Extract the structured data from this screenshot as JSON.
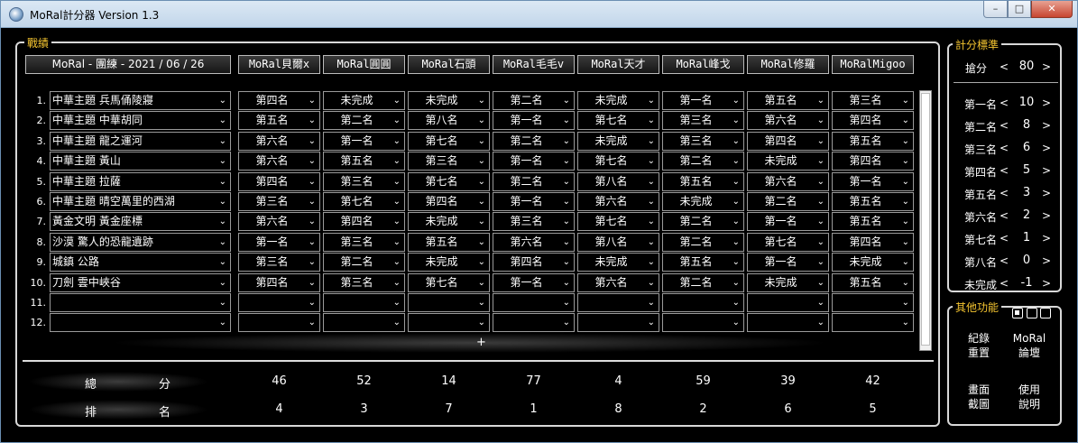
{
  "window": {
    "title": "MoRal計分器 Version 1.3",
    "min": "–",
    "max": "□",
    "close": "✕",
    "icon": "app-icon"
  },
  "score_panel": {
    "legend": "戰績"
  },
  "game_label": "MoRal - 團練 - 2021 / 06 / 26",
  "players": [
    "MoRal貝爾x",
    "MoRal圓圓",
    "MoRal石頭",
    "MoRal毛毛v",
    "MoRal天才",
    "MoRal峰戈",
    "MoRal修羅",
    "MoRalMigoo"
  ],
  "rows": [
    {
      "num": "1.",
      "map": "中華主題 兵馬俑陵寢",
      "ranks": [
        "第四名",
        "未完成",
        "未完成",
        "第二名",
        "未完成",
        "第一名",
        "第五名",
        "第三名"
      ]
    },
    {
      "num": "2.",
      "map": "中華主題 中華胡同",
      "ranks": [
        "第五名",
        "第二名",
        "第八名",
        "第一名",
        "第七名",
        "第三名",
        "第六名",
        "第四名"
      ]
    },
    {
      "num": "3.",
      "map": "中華主題 龍之運河",
      "ranks": [
        "第六名",
        "第一名",
        "第七名",
        "第二名",
        "未完成",
        "第三名",
        "第四名",
        "第五名"
      ]
    },
    {
      "num": "4.",
      "map": "中華主題 黃山",
      "ranks": [
        "第六名",
        "第五名",
        "第三名",
        "第一名",
        "第七名",
        "第二名",
        "未完成",
        "第四名"
      ]
    },
    {
      "num": "5.",
      "map": "中華主題 拉薩",
      "ranks": [
        "第四名",
        "第三名",
        "第七名",
        "第二名",
        "第八名",
        "第五名",
        "第六名",
        "第一名"
      ]
    },
    {
      "num": "6.",
      "map": "中華主題 晴空萬里的西湖",
      "ranks": [
        "第三名",
        "第七名",
        "第四名",
        "第一名",
        "第六名",
        "未完成",
        "第二名",
        "第五名"
      ]
    },
    {
      "num": "7.",
      "map": "黃金文明 黃金座標",
      "ranks": [
        "第六名",
        "第四名",
        "未完成",
        "第三名",
        "第七名",
        "第二名",
        "第一名",
        "第五名"
      ]
    },
    {
      "num": "8.",
      "map": "沙漠 驚人的恐龍遺跡",
      "ranks": [
        "第一名",
        "第三名",
        "第五名",
        "第六名",
        "第八名",
        "第二名",
        "第七名",
        "第四名"
      ]
    },
    {
      "num": "9.",
      "map": "城鎮 公路",
      "ranks": [
        "第三名",
        "第二名",
        "未完成",
        "第四名",
        "未完成",
        "第五名",
        "第一名",
        "未完成"
      ]
    },
    {
      "num": "10.",
      "map": "刀劍 雲中峽谷",
      "ranks": [
        "第四名",
        "第三名",
        "第七名",
        "第一名",
        "第六名",
        "第二名",
        "未完成",
        "第五名"
      ]
    },
    {
      "num": "11.",
      "map": "",
      "ranks": [
        "",
        "",
        "",
        "",
        "",
        "",
        "",
        ""
      ]
    },
    {
      "num": "12.",
      "map": "",
      "ranks": [
        "",
        "",
        "",
        "",
        "",
        "",
        "",
        ""
      ]
    }
  ],
  "add_row": "+",
  "totals": {
    "label_a": "總",
    "label_b": "分",
    "values": [
      "46",
      "52",
      "14",
      "77",
      "4",
      "59",
      "39",
      "42"
    ]
  },
  "rankings": {
    "label_a": "排",
    "label_b": "名",
    "values": [
      "4",
      "3",
      "7",
      "1",
      "8",
      "2",
      "6",
      "5"
    ]
  },
  "rules": {
    "legend": "計分標準",
    "lead": {
      "label": "搶分",
      "value": "80"
    },
    "items": [
      {
        "label": "第一名",
        "value": "10"
      },
      {
        "label": "第二名",
        "value": "8"
      },
      {
        "label": "第三名",
        "value": "6"
      },
      {
        "label": "第四名",
        "value": "5"
      },
      {
        "label": "第五名",
        "value": "3"
      },
      {
        "label": "第六名",
        "value": "2"
      },
      {
        "label": "第七名",
        "value": "1"
      },
      {
        "label": "第八名",
        "value": "0"
      },
      {
        "label": "未完成",
        "value": "-1"
      }
    ],
    "dec": "<",
    "inc": ">"
  },
  "other": {
    "legend": "其他功能",
    "buttons": [
      {
        "l1": "紀錄",
        "l2": "重置"
      },
      {
        "l1": "MoRal",
        "l2": "論壇"
      },
      {
        "l1": "畫面",
        "l2": "截圖"
      },
      {
        "l1": "使用",
        "l2": "說明"
      }
    ]
  }
}
